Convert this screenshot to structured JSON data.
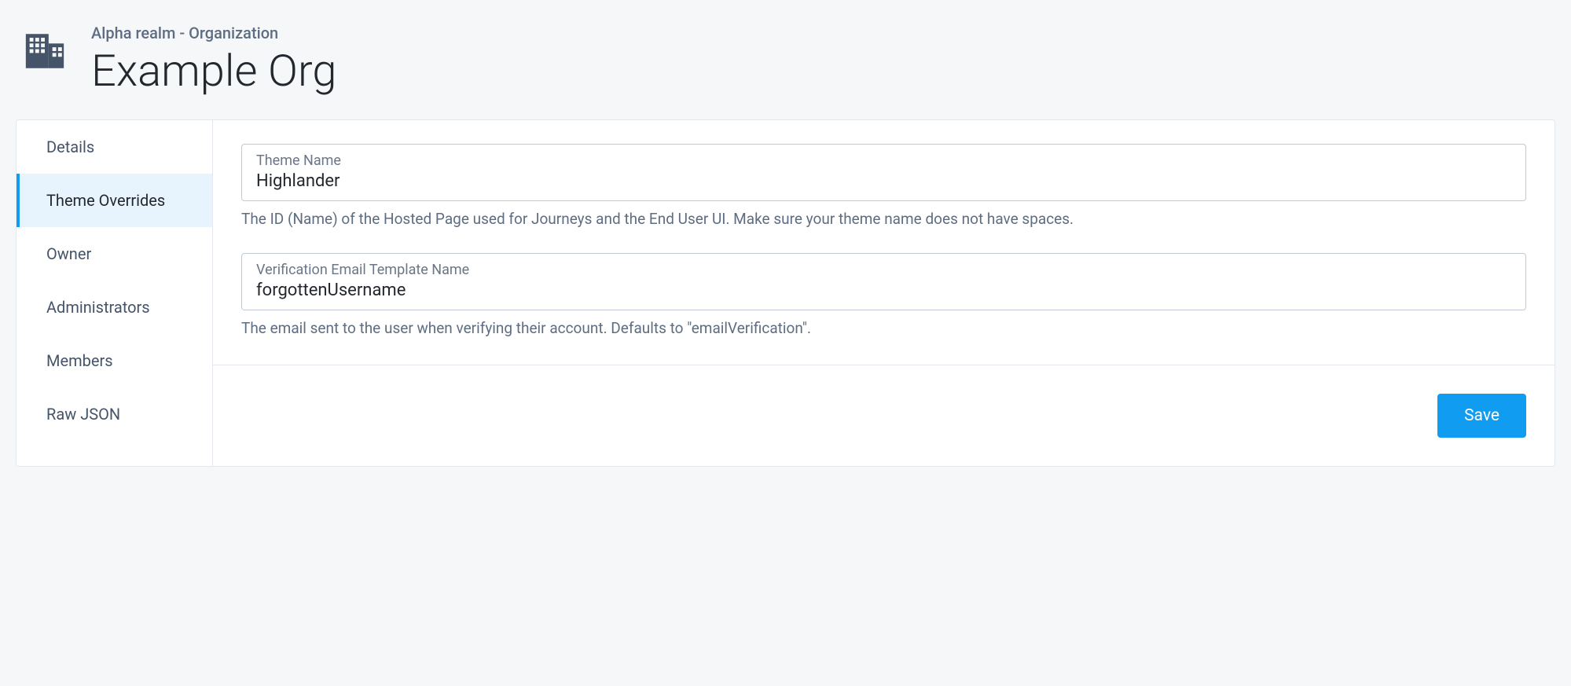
{
  "header": {
    "breadcrumb": "Alpha realm - Organization",
    "title": "Example Org"
  },
  "sidebar": {
    "items": [
      {
        "label": "Details"
      },
      {
        "label": "Theme Overrides"
      },
      {
        "label": "Owner"
      },
      {
        "label": "Administrators"
      },
      {
        "label": "Members"
      },
      {
        "label": "Raw JSON"
      }
    ],
    "activeIndex": 1
  },
  "form": {
    "themeName": {
      "label": "Theme Name",
      "value": "Highlander",
      "help": "The ID (Name) of the Hosted Page used for Journeys and the End User UI. Make sure your theme name does not have spaces."
    },
    "verificationEmail": {
      "label": "Verification Email Template Name",
      "value": "forgottenUsername",
      "help": "The email sent to the user when verifying their account. Defaults to \"emailVerification\"."
    }
  },
  "buttons": {
    "save": "Save"
  }
}
